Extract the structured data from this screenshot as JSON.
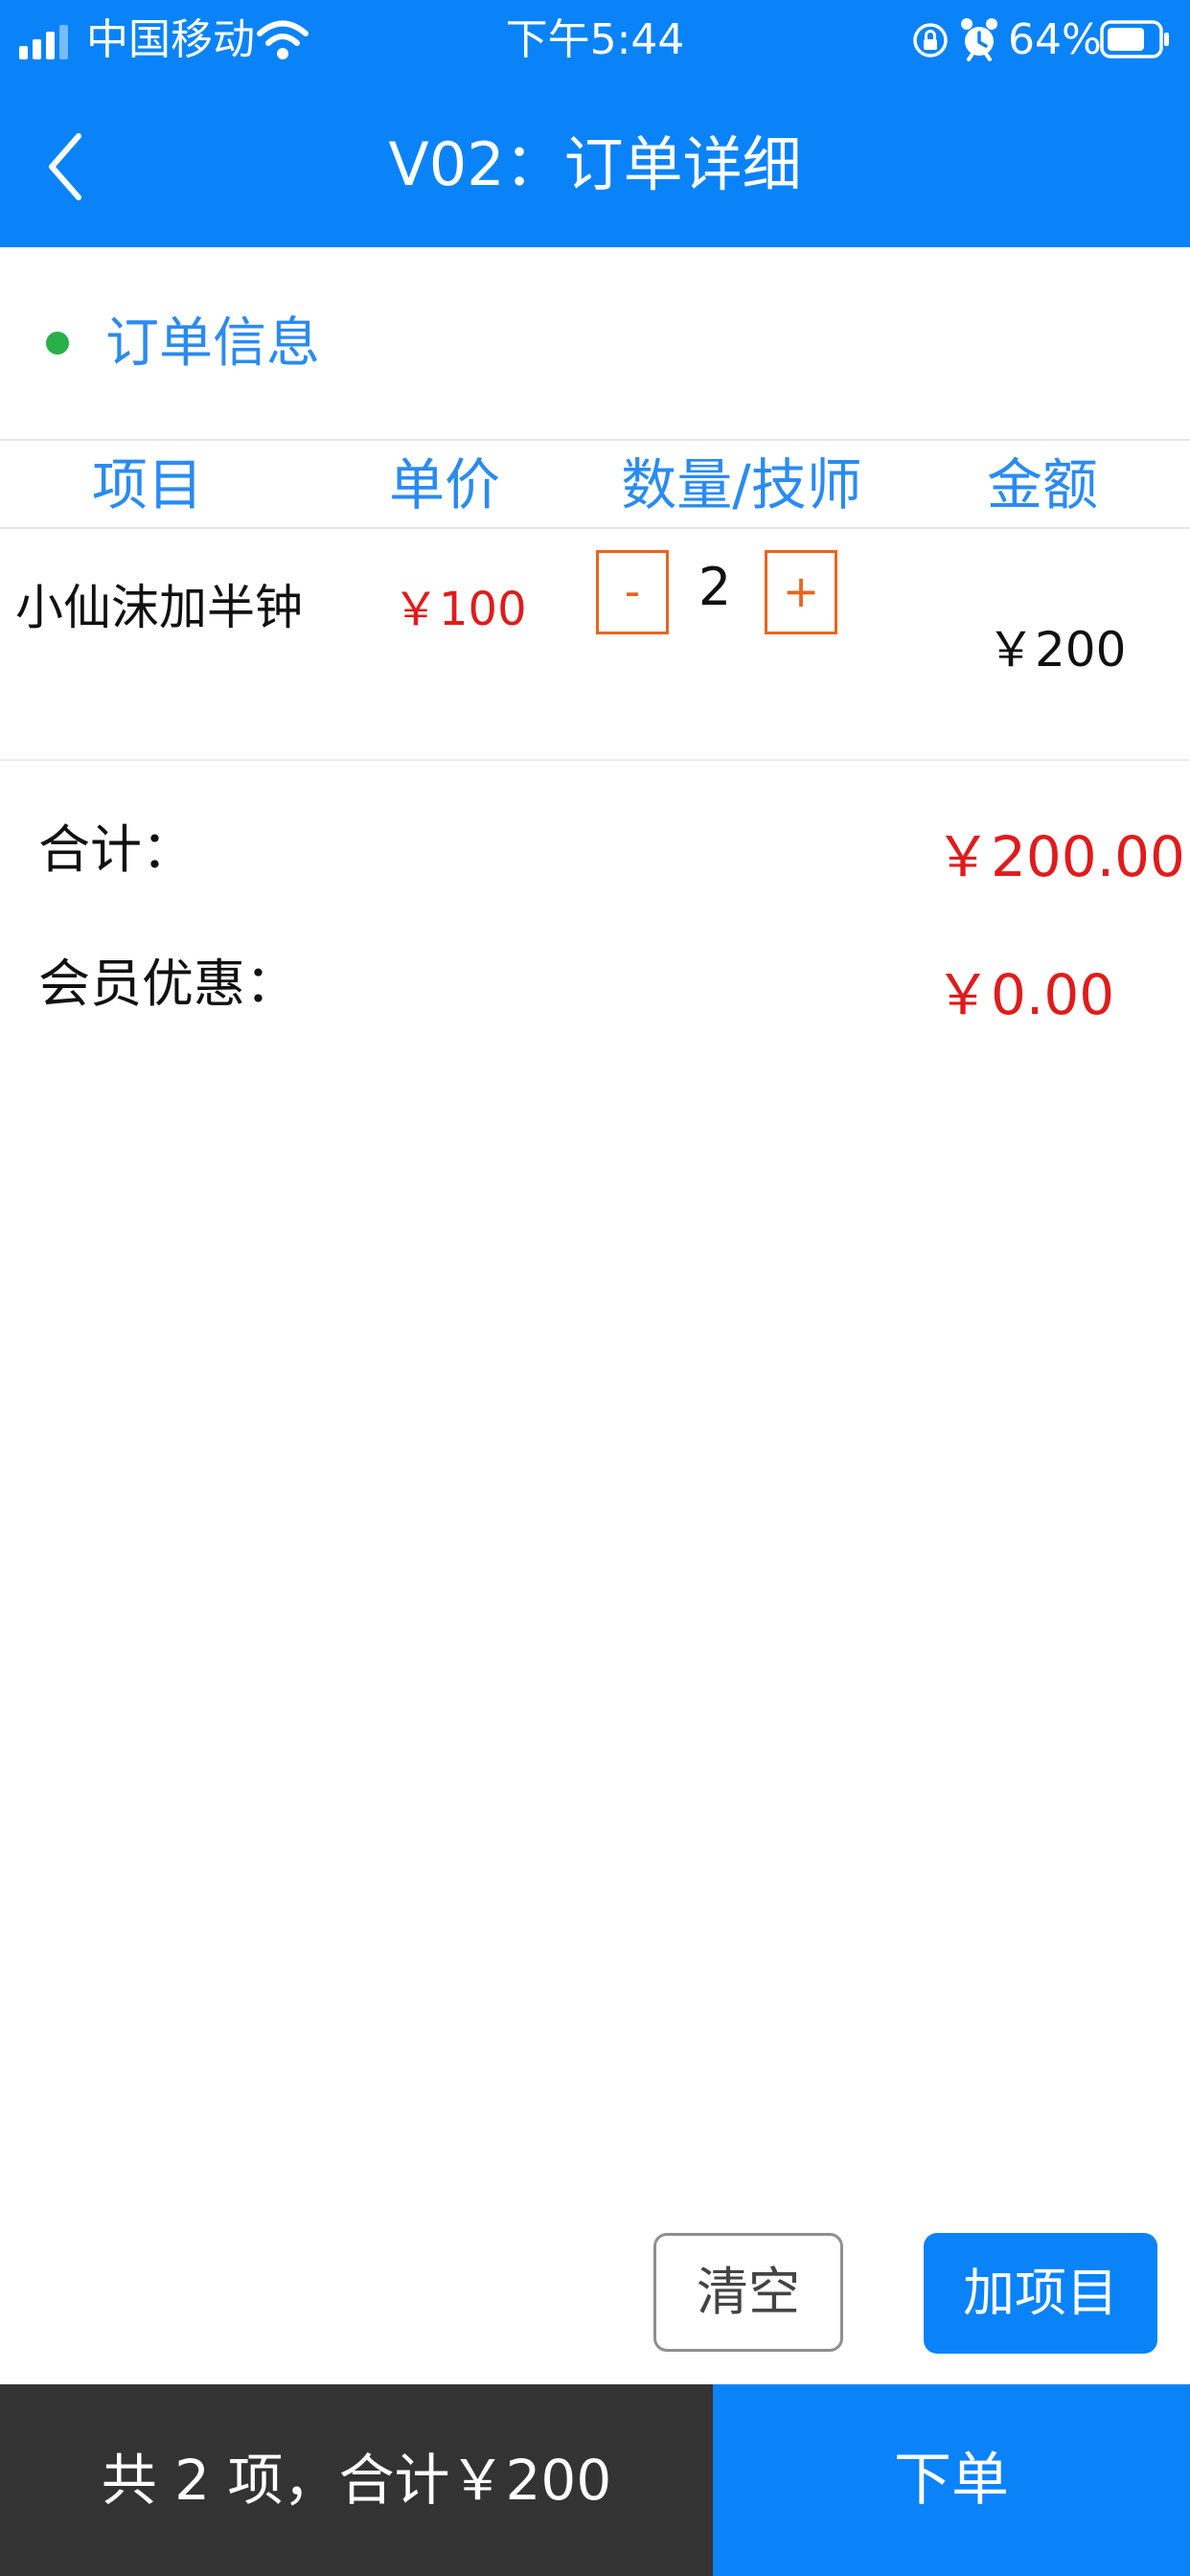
{
  "status_bar": {
    "carrier": "中国移动",
    "time": "下午5:44",
    "battery": "64%",
    "icons": [
      "signal-icon",
      "wifi-icon",
      "rotation-lock-icon",
      "alarm-icon",
      "battery-icon"
    ]
  },
  "nav": {
    "back_icon": "chevron-left-icon",
    "title": "V02：订单详细"
  },
  "section": {
    "title": "订单信息"
  },
  "table": {
    "columns": [
      "项目",
      "单价",
      "数量/技师",
      "金额"
    ],
    "rows": [
      {
        "name": "小仙沫加半钟",
        "price": "￥100",
        "minus": "-",
        "quantity": "2",
        "plus": "+",
        "amount": "￥200"
      }
    ]
  },
  "totals": {
    "total_label": "合计：",
    "total_value": "￥200.00",
    "discount_label": "会员优惠：",
    "discount_value": "￥0.00"
  },
  "actions": {
    "clear": "清空",
    "add": "加项目"
  },
  "bottom": {
    "summary": "共 2 项，合计￥200",
    "order": "下单"
  },
  "colors": {
    "primary": "#0a83f8",
    "accent_text": "#2a8bf2",
    "price_red": "#e11b1b",
    "stepper_orange": "#e8651f",
    "status_green": "#2ab04a",
    "bottom_dark": "#333333"
  }
}
